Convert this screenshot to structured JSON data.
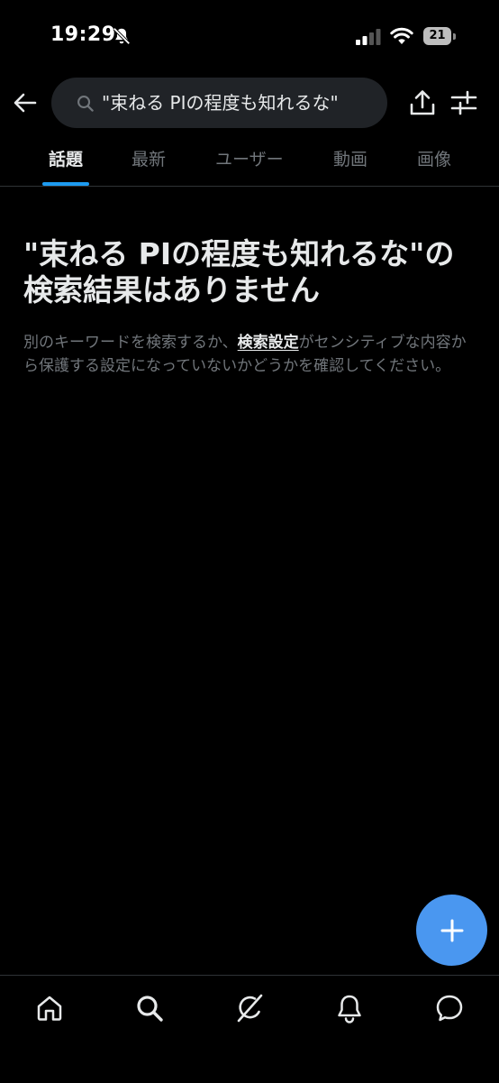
{
  "status_bar": {
    "time": "19:29",
    "battery": "21"
  },
  "search": {
    "query": "\"束ねる PIの程度も知れるな\""
  },
  "tabs": [
    {
      "label": "話題",
      "active": true
    },
    {
      "label": "最新",
      "active": false
    },
    {
      "label": "ユーザー",
      "active": false
    },
    {
      "label": "動画",
      "active": false
    },
    {
      "label": "画像",
      "active": false
    }
  ],
  "empty_state": {
    "title": "\"束ねる PIの程度も知れるな\"の検索結果はありません",
    "desc_before": "別のキーワードを検索するか、",
    "desc_link": "検索設定",
    "desc_after": "がセンシティブな内容から保護する設定になっていないかどうかを確認してください。"
  },
  "icons": {
    "back": "arrow-left-icon",
    "search": "search-icon",
    "share": "share-icon",
    "filter": "filter-sliders-icon",
    "fab": "plus-icon",
    "nav": [
      "home-icon",
      "search-icon",
      "grok-icon",
      "bell-icon",
      "messages-icon"
    ]
  },
  "colors": {
    "background": "#000000",
    "accent": "#1d9bf0",
    "fab": "#4a97f0",
    "muted_text": "#71767b",
    "primary_text": "#e7e9ea"
  }
}
